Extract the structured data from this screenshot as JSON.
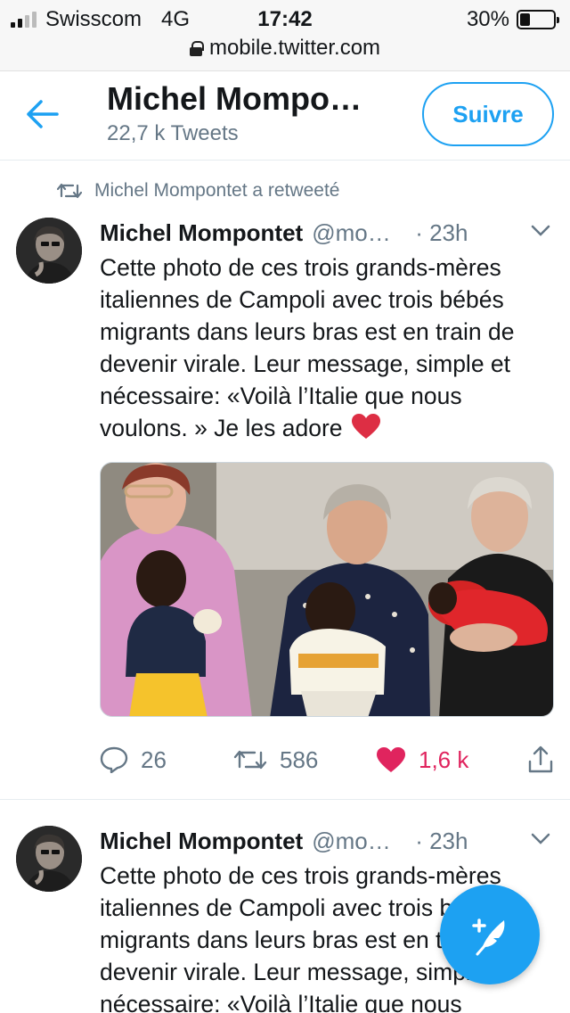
{
  "status_bar": {
    "carrier": "Swisscom",
    "network": "4G",
    "time": "17:42",
    "battery": "30%",
    "battery_level": 0.3,
    "url": "mobile.twitter.com"
  },
  "header": {
    "back_icon": "arrow-left-icon",
    "name": "Michel Mompo…",
    "tweet_count": "22,7 k Tweets",
    "follow_label": "Suivre"
  },
  "colors": {
    "accent": "#1da1f2",
    "like": "#e0245e",
    "muted": "#657786"
  },
  "tweets": [
    {
      "retweet_label": "Michel Mompontet a retweeté",
      "author": "Michel Mompontet",
      "handle": "@mo…",
      "time": "· 23h",
      "text": "Cette photo de ces trois grands-mères italiennes de Campoli avec trois bébés migrants dans leurs bras est en train de devenir virale. Leur message, simple et nécessaire: «Voilà l’Italie que nous voulons. » Je les adore",
      "replies": "26",
      "retweets": "586",
      "likes": "1,6 k"
    },
    {
      "author": "Michel Mompontet",
      "handle": "@mo…",
      "time": "· 23h",
      "text": "Cette photo de ces trois grands-mères italiennes de Campoli avec trois bébés migrants dans leurs bras est en train de devenir virale. Leur message, simple et nécessaire: «Voilà l’Italie que nous"
    }
  ],
  "compose_icon": "compose-feather-icon"
}
